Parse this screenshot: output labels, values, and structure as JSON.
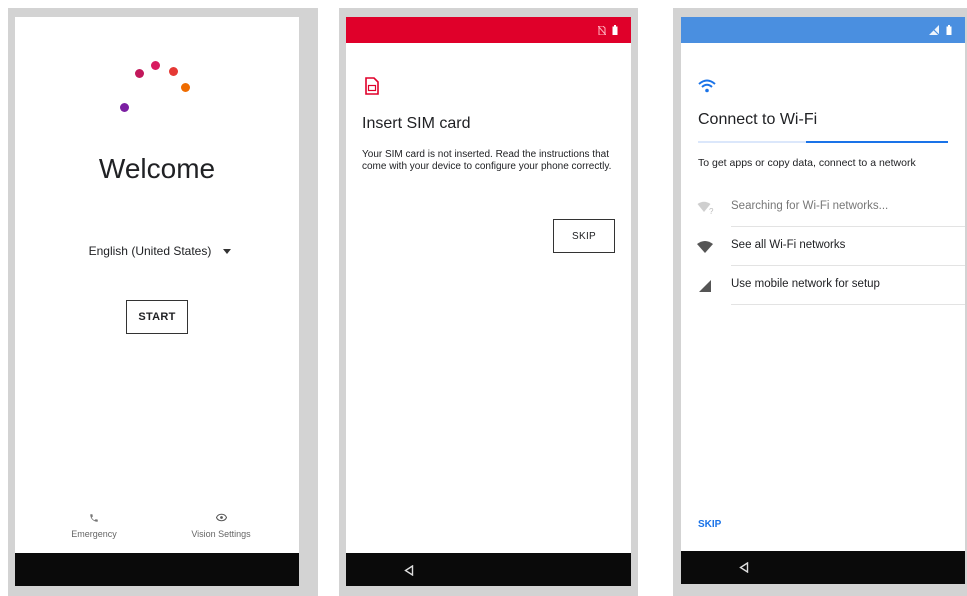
{
  "screens": {
    "welcome": {
      "title": "Welcome",
      "language": "English (United States)",
      "start_button": "START",
      "emergency": "Emergency",
      "vision_settings": "Vision Settings",
      "logo_colors": [
        "#7b1fa2",
        "#c2185b",
        "#d81b60",
        "#e53935",
        "#ef6c00"
      ]
    },
    "sim": {
      "status_bar_color": "#e0002a",
      "title": "Insert SIM card",
      "body": "Your SIM card is not inserted. Read the instructions that come with your device to configure your phone correctly.",
      "skip_button": "SKIP"
    },
    "wifi": {
      "status_bar_color": "#4a8fe0",
      "title": "Connect to Wi-Fi",
      "subtitle": "To get apps or copy data, connect to a network",
      "items": [
        {
          "icon": "wifi-searching-icon",
          "label": "Searching for Wi-Fi networks..."
        },
        {
          "icon": "wifi-icon",
          "label": "See all Wi-Fi networks"
        },
        {
          "icon": "cellular-signal-icon",
          "label": "Use mobile network for setup"
        }
      ],
      "skip_link": "SKIP",
      "accent": "#1a73e8"
    }
  }
}
